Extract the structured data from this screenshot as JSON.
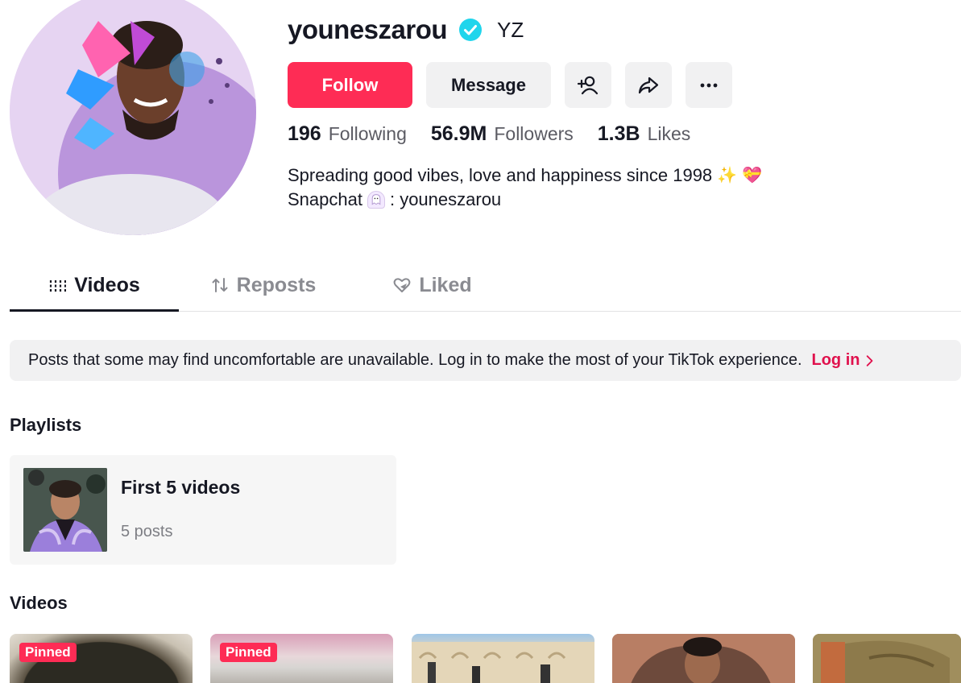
{
  "profile": {
    "username": "youneszarou",
    "nickname": "YZ",
    "verified": true,
    "avatar_icon": "profile-avatar"
  },
  "actions": {
    "follow_label": "Follow",
    "message_label": "Message",
    "add_friend_icon": "add-user-icon",
    "share_icon": "share-icon",
    "more_icon": "more-icon"
  },
  "stats": {
    "following_count": "196",
    "following_label": "Following",
    "followers_count": "56.9M",
    "followers_label": "Followers",
    "likes_count": "1.3B",
    "likes_label": "Likes"
  },
  "bio": {
    "line1": "Spreading good vibes, love and happiness since 1998",
    "line1_emoji1": "✨",
    "line1_emoji2": "💝",
    "line2_prefix": "Snapchat",
    "line2_suffix": ": youneszarou"
  },
  "tabs": [
    {
      "label": "Videos",
      "icon": "grid-icon",
      "active": true
    },
    {
      "label": "Reposts",
      "icon": "repost-icon",
      "active": false
    },
    {
      "label": "Liked",
      "icon": "liked-icon",
      "active": false
    }
  ],
  "notice": {
    "text": "Posts that some may find uncomfortable are unavailable. Log in to make the most of your TikTok experience.",
    "login_label": "Log in"
  },
  "playlists": {
    "heading": "Playlists",
    "items": [
      {
        "title": "First 5 videos",
        "count": "5 posts"
      }
    ]
  },
  "videos": {
    "heading": "Videos",
    "items": [
      {
        "pinned_label": "Pinned"
      },
      {
        "pinned_label": "Pinned"
      },
      {
        "pinned_label": ""
      },
      {
        "pinned_label": ""
      },
      {
        "pinned_label": ""
      }
    ]
  },
  "colors": {
    "accent": "#fe2c55",
    "text_primary": "#161823",
    "text_secondary": "#5b5b63",
    "verified": "#20d5ec",
    "button_bg": "#f1f1f2"
  }
}
